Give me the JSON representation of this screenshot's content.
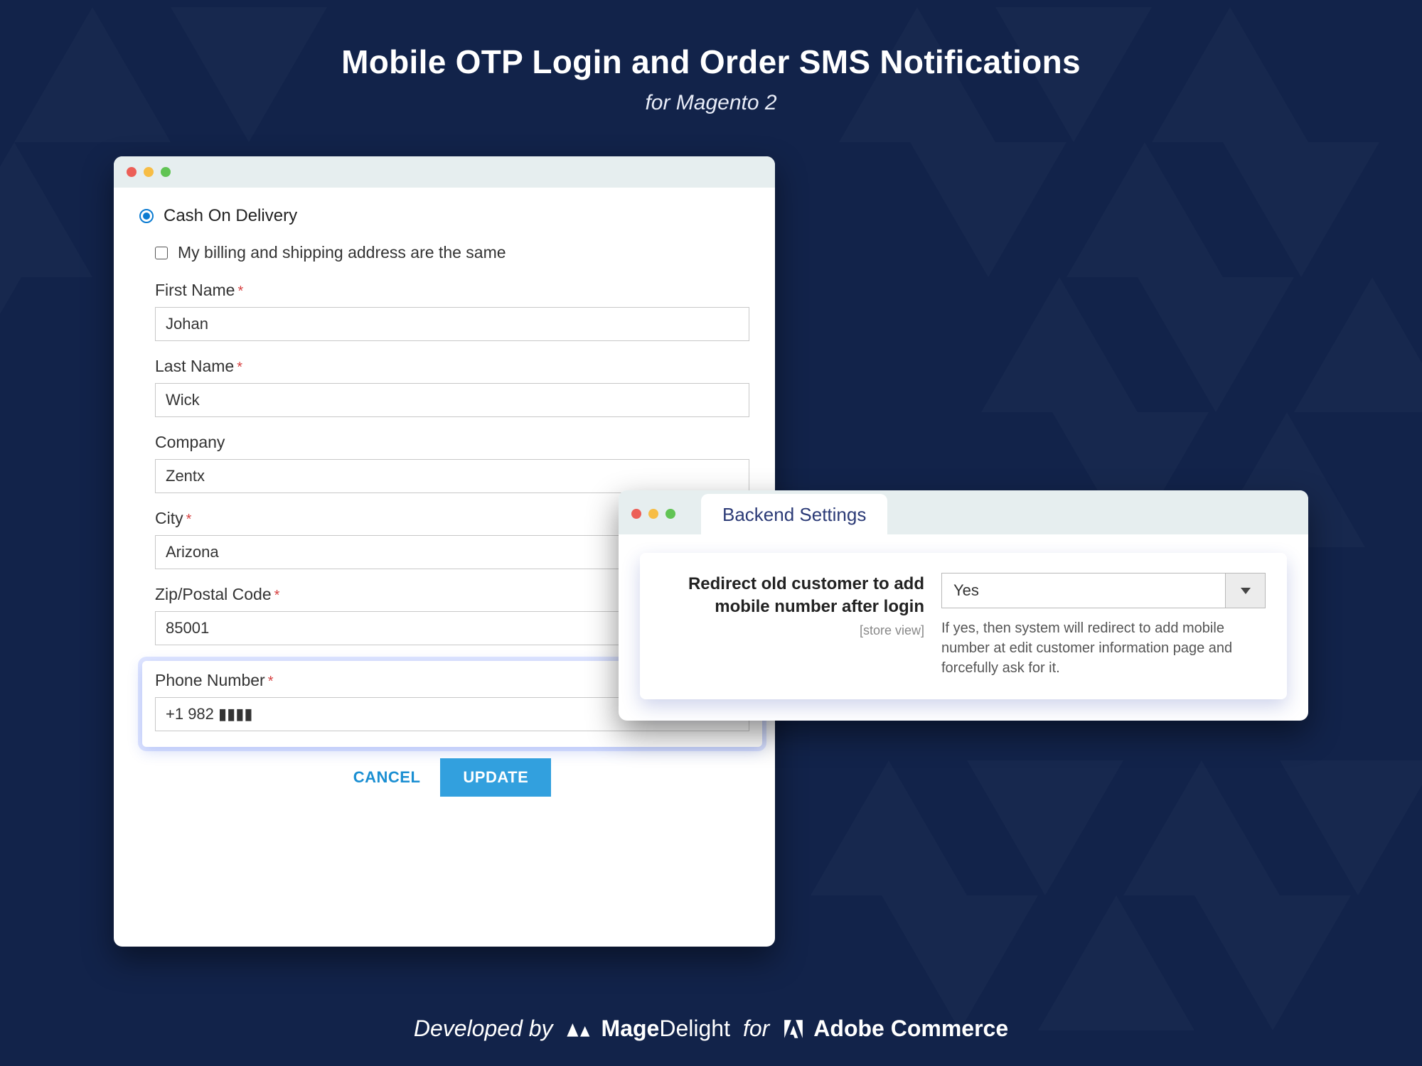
{
  "heading": {
    "title": "Mobile OTP Login and Order SMS Notifications",
    "subtitle": "for Magento 2"
  },
  "checkout": {
    "payment_method_label": "Cash On Delivery",
    "same_address_label": "My billing and shipping address are the same",
    "fields": {
      "first_name": {
        "label": "First Name",
        "value": "Johan",
        "required": true
      },
      "last_name": {
        "label": "Last Name",
        "value": "Wick",
        "required": true
      },
      "company": {
        "label": "Company",
        "value": "Zentx",
        "required": false
      },
      "city": {
        "label": "City",
        "value": "Arizona",
        "required": true
      },
      "zip": {
        "label": "Zip/Postal Code",
        "value": "85001",
        "required": true
      },
      "phone": {
        "label": "Phone Number",
        "value": "+1 982 ▮▮▮▮",
        "required": true
      }
    },
    "buttons": {
      "cancel": "CANCEL",
      "update": "UPDATE"
    }
  },
  "settings": {
    "tab_title": "Backend Settings",
    "option_label": "Redirect old customer to add mobile number after login",
    "scope": "[store view]",
    "select_value": "Yes",
    "help_text": "If yes, then system will redirect to add mobile number at edit customer information page and forcefully ask for it."
  },
  "footer": {
    "developed_by": "Developed by",
    "brand1": "MageDelight",
    "for": "for",
    "brand2": "Adobe Commerce"
  }
}
